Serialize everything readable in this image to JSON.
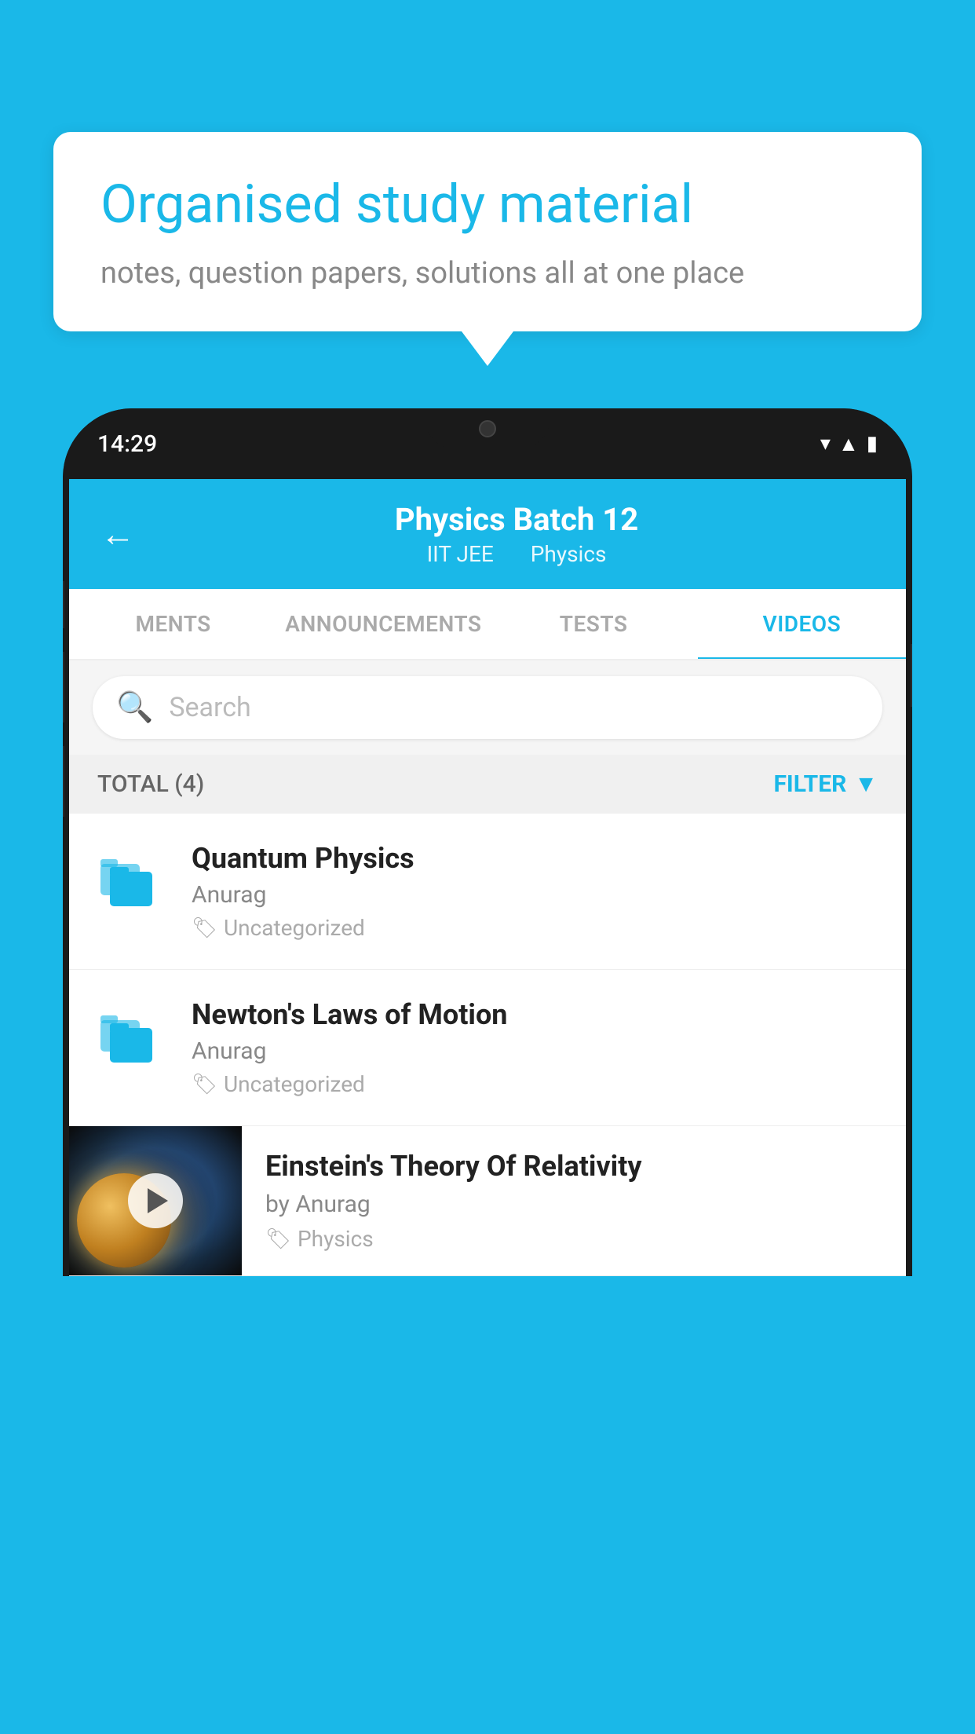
{
  "background": {
    "color": "#1ab8e8"
  },
  "speech_bubble": {
    "title": "Organised study material",
    "subtitle": "notes, question papers, solutions all at one place"
  },
  "phone": {
    "status_bar": {
      "time": "14:29"
    },
    "header": {
      "title": "Physics Batch 12",
      "subtitle_part1": "IIT JEE",
      "subtitle_part2": "Physics",
      "back_label": "←"
    },
    "tabs": [
      {
        "label": "MENTS",
        "active": false
      },
      {
        "label": "ANNOUNCEMENTS",
        "active": false
      },
      {
        "label": "TESTS",
        "active": false
      },
      {
        "label": "VIDEOS",
        "active": true
      }
    ],
    "search": {
      "placeholder": "Search"
    },
    "filter_bar": {
      "total_label": "TOTAL (4)",
      "filter_label": "FILTER"
    },
    "video_items": [
      {
        "title": "Quantum Physics",
        "author": "Anurag",
        "tag": "Uncategorized",
        "has_thumbnail": false
      },
      {
        "title": "Newton's Laws of Motion",
        "author": "Anurag",
        "tag": "Uncategorized",
        "has_thumbnail": false
      },
      {
        "title": "Einstein's Theory Of Relativity",
        "author": "by Anurag",
        "tag": "Physics",
        "has_thumbnail": true
      }
    ]
  }
}
